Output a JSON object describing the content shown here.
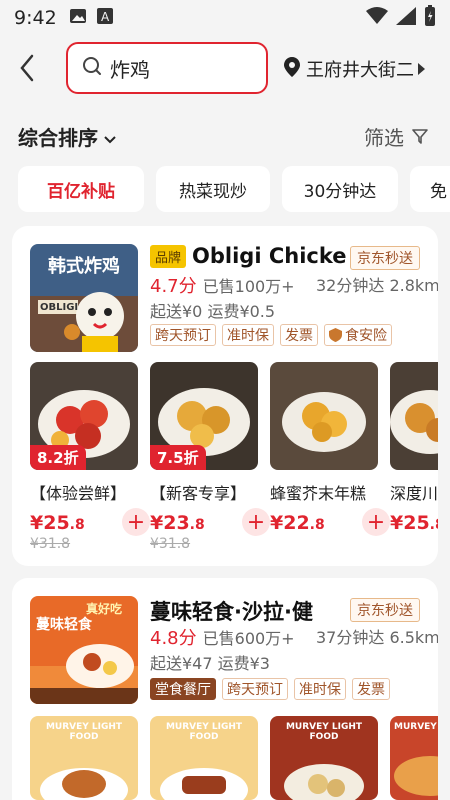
{
  "status": {
    "time": "9:42"
  },
  "search": {
    "query": "炸鸡"
  },
  "location": {
    "label": "王府井大街二"
  },
  "sort": {
    "label": "综合排序",
    "filter_label": "筛选"
  },
  "chips": [
    "百亿补贴",
    "热菜现炒",
    "30分钟达",
    "免"
  ],
  "stores": [
    {
      "logo_text": "韩式炸鸡",
      "logo_sub": "OBLIGI",
      "badge": "品牌",
      "name": "Obligi Chicke",
      "jd": "京东秒送",
      "score": "4.7分",
      "sold": "已售100万+",
      "eta": "32分钟达 2.8km",
      "fees": "起送¥0  运费¥0.5",
      "tags": [
        "跨天预订",
        "准时保",
        "发票",
        "食安险"
      ],
      "dishes": [
        {
          "name": "【体验尝鲜】",
          "discount": "8.2折",
          "price_int": "¥25",
          "price_dec": ".8",
          "old": "¥31.8"
        },
        {
          "name": "【新客专享】",
          "discount": "7.5折",
          "price_int": "¥23",
          "price_dec": ".8",
          "old": "¥31.8"
        },
        {
          "name": "蜂蜜芥末年糕",
          "discount": "",
          "price_int": "¥22",
          "price_dec": ".8",
          "old": ""
        },
        {
          "name": "深度川",
          "discount": "",
          "price_int": "¥25",
          "price_dec": ".8",
          "old": ""
        }
      ]
    },
    {
      "logo_text": "蔓味轻食",
      "logo_sub": "真好吃",
      "badge": "",
      "name": "蔓味轻食·沙拉·健",
      "jd": "京东秒送",
      "score": "4.8分",
      "sold": "已售600万+",
      "eta": "37分钟达 6.5km",
      "fees": "起送¥47  运费¥3",
      "tags": [
        "堂食餐厅",
        "跨天预订",
        "准时保",
        "发票"
      ],
      "dish_banner": "MURVEY LIGHT FOOD"
    }
  ]
}
